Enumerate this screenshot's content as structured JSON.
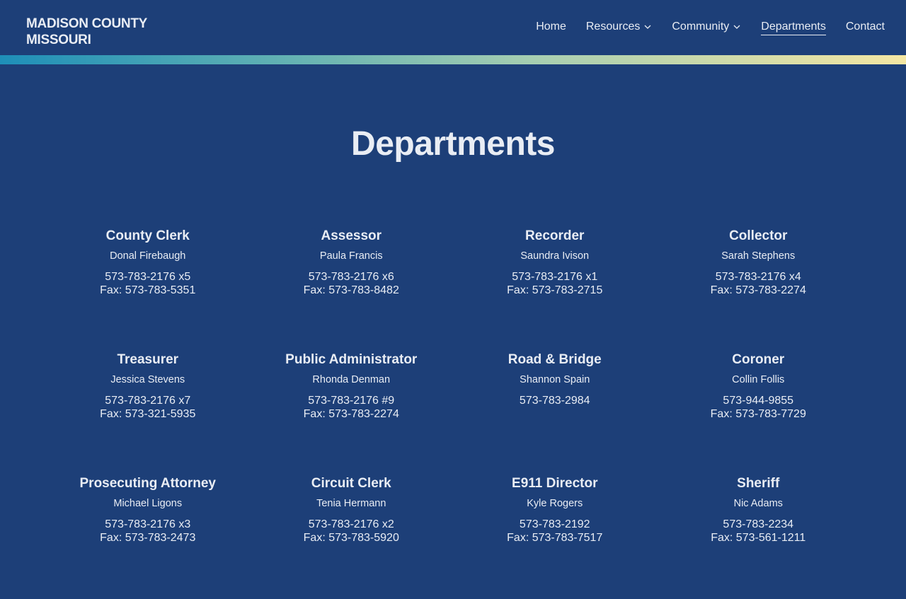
{
  "header": {
    "brand_line1": "MADISON COUNTY",
    "brand_line2": "MISSOURI",
    "nav": [
      {
        "label": "Home",
        "dropdown": false,
        "active": false
      },
      {
        "label": "Resources",
        "dropdown": true,
        "active": false
      },
      {
        "label": "Community",
        "dropdown": true,
        "active": false
      },
      {
        "label": "Departments",
        "dropdown": false,
        "active": true
      },
      {
        "label": "Contact",
        "dropdown": false,
        "active": false
      }
    ]
  },
  "colors": {
    "background": "#1d3f78",
    "text": "#e9edf4",
    "gradient_start": "#1e8fb8",
    "gradient_end": "#f4e6a3"
  },
  "page": {
    "title": "Departments"
  },
  "departments": [
    {
      "name": "County Clerk",
      "person": "Donal Firebaugh",
      "phone": "573-783-2176 x5",
      "fax": "Fax: 573-783-5351"
    },
    {
      "name": "Assessor",
      "person": "Paula Francis",
      "phone": "573-783-2176 x6",
      "fax": "Fax: 573-783-8482"
    },
    {
      "name": "Recorder",
      "person": "Saundra Ivison",
      "phone": "573-783-2176 x1",
      "fax": "Fax: 573-783-2715"
    },
    {
      "name": "Collector",
      "person": "Sarah Stephens",
      "phone": "573-783-2176 x4",
      "fax": "Fax: 573-783-2274"
    },
    {
      "name": "Treasurer",
      "person": "Jessica Stevens",
      "phone": "573-783-2176 x7",
      "fax": "Fax: 573-321-5935"
    },
    {
      "name": "Public Administrator",
      "person": "Rhonda Denman",
      "phone": "573-783-2176 #9",
      "fax": "Fax: 573-783-2274"
    },
    {
      "name": "Road & Bridge",
      "person": "Shannon Spain",
      "phone": "573-783-2984",
      "fax": ""
    },
    {
      "name": "Coroner",
      "person": "Collin Follis",
      "phone": "573-944-9855",
      "fax": "Fax: 573-783-7729"
    },
    {
      "name": "Prosecuting Attorney",
      "person": "Michael Ligons",
      "phone": "573-783-2176 x3",
      "fax": "Fax: 573-783-2473"
    },
    {
      "name": "Circuit Clerk",
      "person": "Tenia Hermann",
      "phone": "573-783-2176 x2",
      "fax": "Fax: 573-783-5920"
    },
    {
      "name": "E911 Director",
      "person": "Kyle Rogers",
      "phone": "573-783-2192",
      "fax": "Fax: 573-783-7517"
    },
    {
      "name": "Sheriff",
      "person": "Nic Adams",
      "phone": "573-783-2234",
      "fax": "Fax: 573-561-1211"
    }
  ]
}
